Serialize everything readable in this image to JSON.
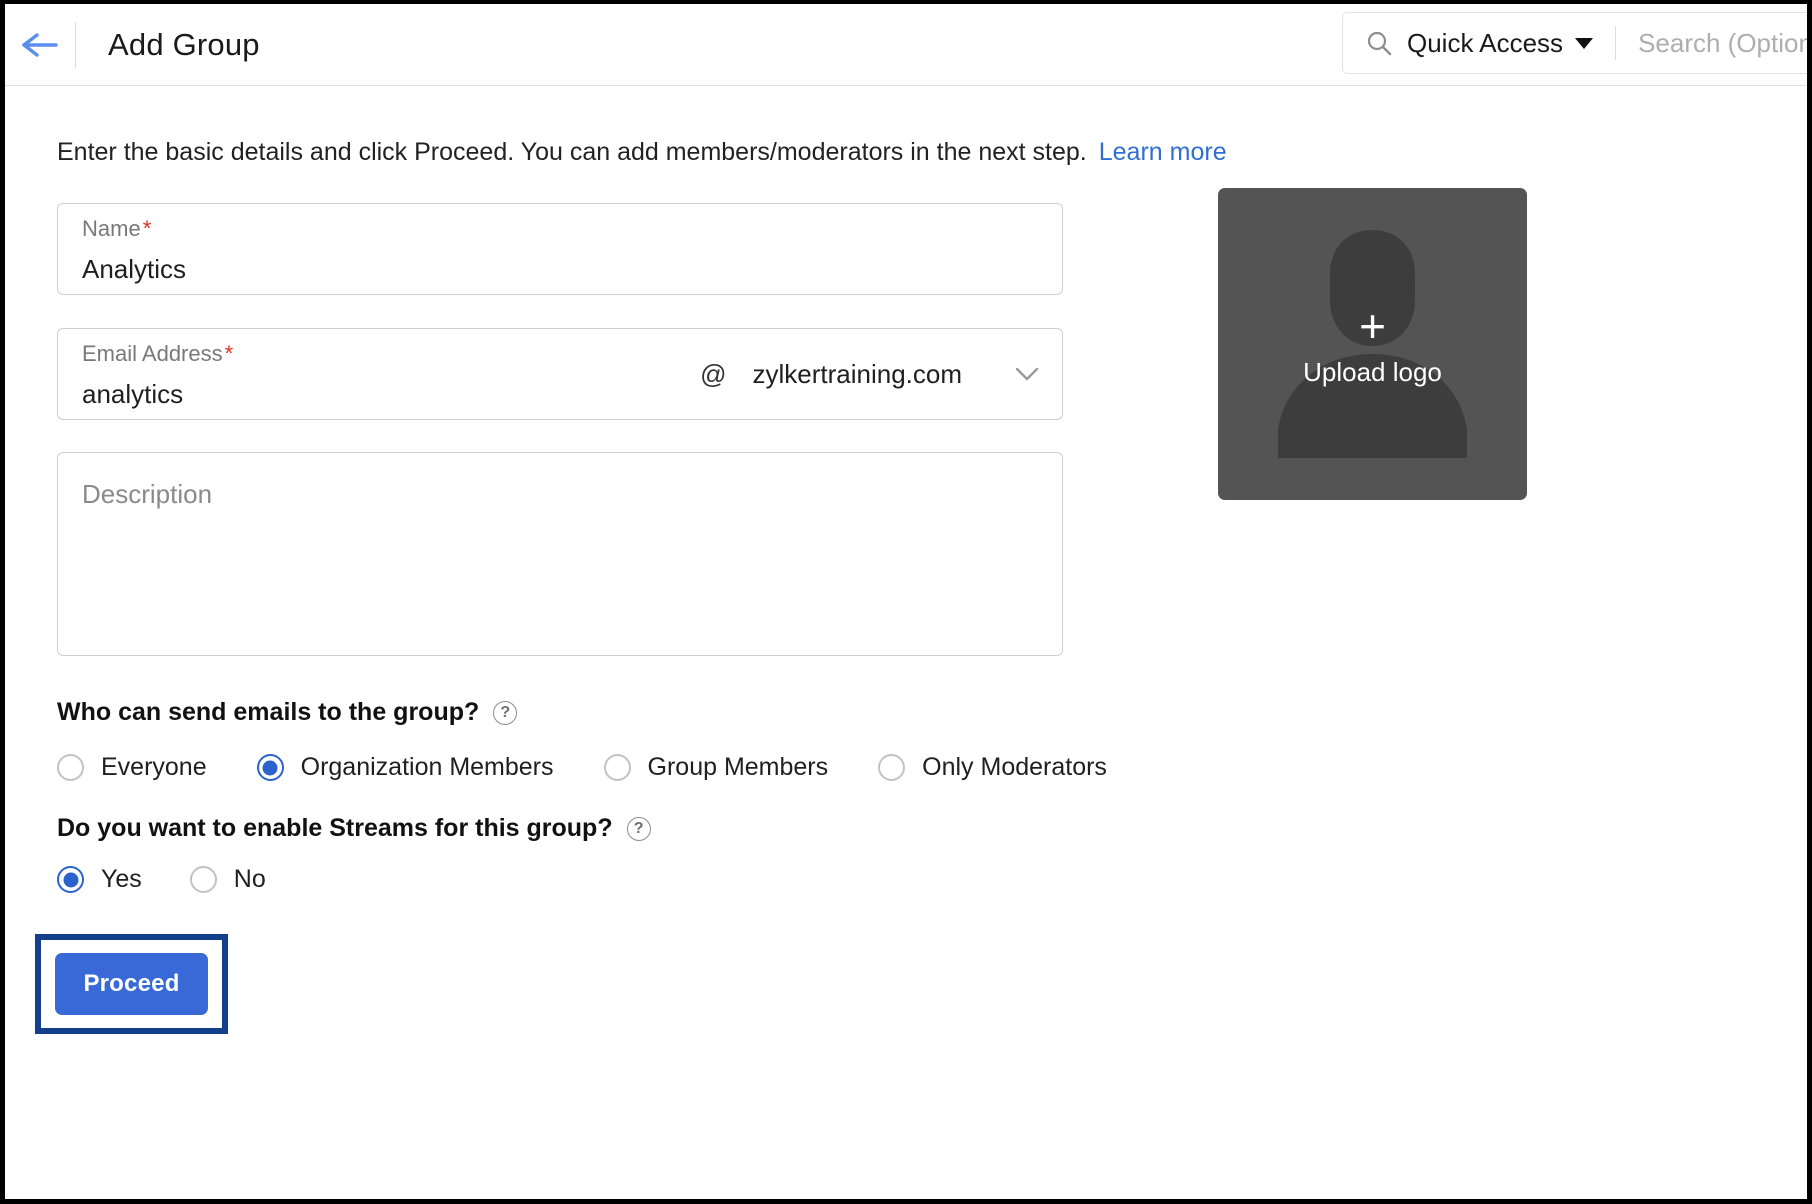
{
  "header": {
    "back_icon": "back-arrow-icon",
    "title": "Add Group",
    "search": {
      "icon": "search-icon",
      "quick_access_label": "Quick Access",
      "caret_icon": "chevron-down-icon",
      "placeholder": "Search (Optional)"
    }
  },
  "intro": {
    "text": "Enter the basic details and click Proceed. You can add members/moderators in the next step.",
    "link_label": "Learn more"
  },
  "form": {
    "name_field": {
      "label": "Name",
      "required_mark": "*",
      "value": "Analytics"
    },
    "email_field": {
      "label": "Email Address",
      "required_mark": "*",
      "value": "analytics",
      "at_symbol": "@",
      "domain": "zylkertraining.com",
      "chevron_icon": "chevron-down-icon"
    },
    "description_field": {
      "placeholder": "Description"
    }
  },
  "questions": {
    "send_emails": {
      "title": "Who can send emails to the group?",
      "help_icon": "?",
      "options": [
        {
          "label": "Everyone",
          "checked": false
        },
        {
          "label": "Organization Members",
          "checked": true
        },
        {
          "label": "Group Members",
          "checked": false
        },
        {
          "label": "Only Moderators",
          "checked": false
        }
      ]
    },
    "streams": {
      "title": "Do you want to enable Streams for this group?",
      "help_icon": "?",
      "options": [
        {
          "label": "Yes",
          "checked": true
        },
        {
          "label": "No",
          "checked": false
        }
      ]
    }
  },
  "actions": {
    "proceed_label": "Proceed"
  },
  "logo_uploader": {
    "plus_glyph": "+",
    "label": "Upload logo",
    "icon": "person-placeholder-icon"
  },
  "colors": {
    "accent_blue": "#3969d6",
    "radio_blue": "#2c62cd",
    "link_blue": "#2f6fd0",
    "highlight_border": "#12408c",
    "required_red": "#d93025",
    "logo_bg": "#545454",
    "logo_silhouette": "#3d3d3d"
  }
}
